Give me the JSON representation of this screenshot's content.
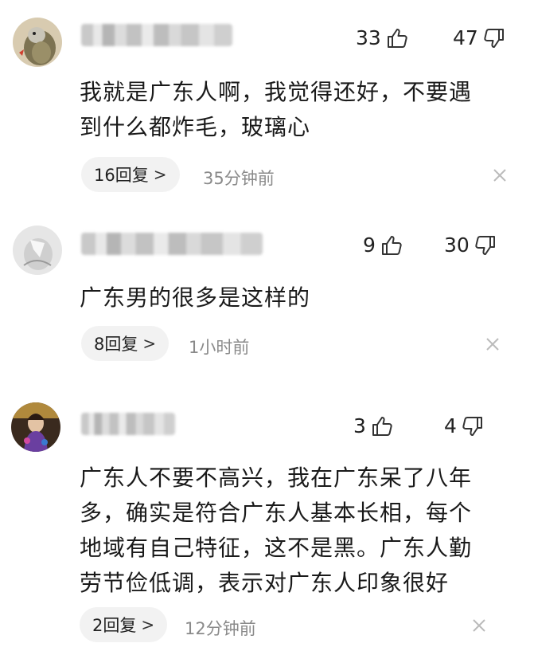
{
  "comments": [
    {
      "likes": "33",
      "dislikes": "47",
      "text_lines": [
        "我就是广东人啊，我觉得还好，不要遇",
        "到什么都炸毛，玻璃心"
      ],
      "replies": "16回复",
      "time": "35分钟前"
    },
    {
      "likes": "9",
      "dislikes": "30",
      "text_lines": [
        "广东男的很多是这样的"
      ],
      "replies": "8回复",
      "time": "1小时前"
    },
    {
      "likes": "3",
      "dislikes": "4",
      "text_lines": [
        "广东人不要不高兴，我在广东呆了八年",
        "多，确实是符合广东人基本长相，每个",
        "地域有自己特征，这不是黑。广东人勤",
        "劳节俭低调，表示对广东人印象很好"
      ],
      "replies": "2回复",
      "time": "12分钟前"
    }
  ],
  "icons": {
    "like": "thumbs-up-icon",
    "dislike": "thumbs-down-icon",
    "chevron": "chevron-right-icon",
    "close": "close-icon"
  },
  "colors": {
    "text": "#1a1a1a",
    "muted": "#8a8a8a",
    "pill_bg": "#f2f2f2",
    "icon": "#bbbbbb"
  }
}
